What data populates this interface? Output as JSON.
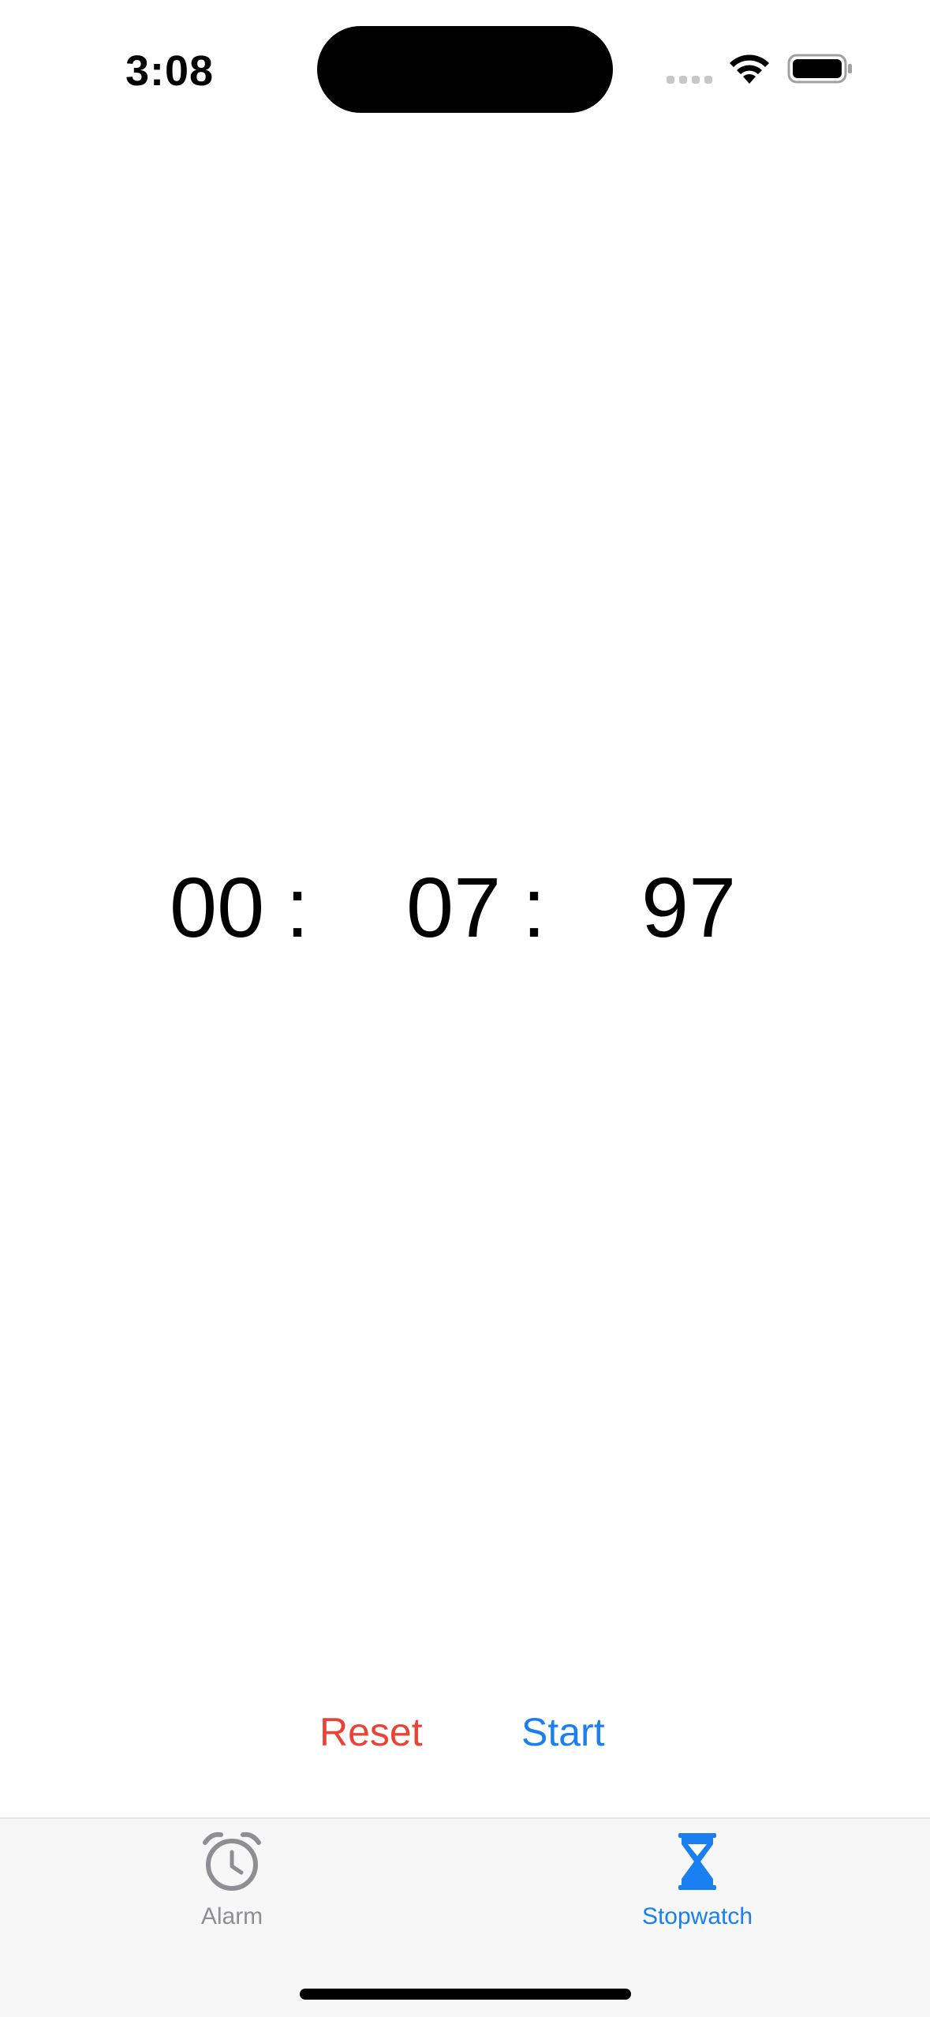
{
  "status_bar": {
    "time": "3:08"
  },
  "timer": {
    "minutes": "00",
    "separator_1": ":",
    "seconds": "07",
    "separator_2": ":",
    "centiseconds": "97"
  },
  "controls": {
    "reset_label": "Reset",
    "start_label": "Start"
  },
  "tab_bar": {
    "tabs": [
      {
        "label": "Alarm",
        "icon": "alarm-clock-icon",
        "selected": false
      },
      {
        "label": "Stopwatch",
        "icon": "hourglass-icon",
        "selected": true
      }
    ]
  },
  "colors": {
    "accent": "#1a7ff0",
    "destructive": "#ea4335",
    "inactive_tab": "#8e8e93",
    "tab_bar_bg": "#f7f7f7"
  }
}
